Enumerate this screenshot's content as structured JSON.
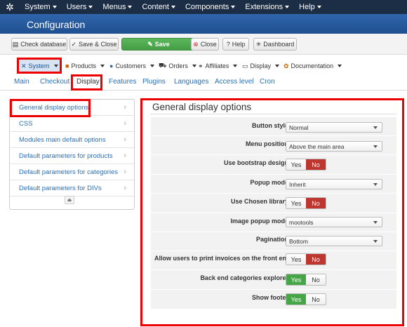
{
  "topmenu": {
    "items": [
      "System",
      "Users",
      "Menus",
      "Content",
      "Components",
      "Extensions",
      "Help"
    ]
  },
  "header": {
    "title": "Configuration"
  },
  "toolbar": {
    "check_database": "Check database",
    "save_close": "Save & Close",
    "save": "Save",
    "close": "Close",
    "help": "Help",
    "dashboard": "Dashboard"
  },
  "component_menu": {
    "items": [
      "System",
      "Products",
      "Customers",
      "Orders",
      "Affiliates",
      "Display",
      "Documentation"
    ],
    "active": "System"
  },
  "tabs": {
    "items": [
      "Main",
      "Checkout",
      "Display",
      "Features",
      "Plugins",
      "Languages",
      "Access level",
      "Cron"
    ],
    "active": "Display"
  },
  "sidebar": {
    "items": [
      "General display options",
      "CSS",
      "Modules main default options",
      "Default parameters for products",
      "Default parameters for categories",
      "Default parameters for DIVs"
    ],
    "active": "General display options"
  },
  "panel": {
    "title": "General display options",
    "fields": {
      "button_style": {
        "label": "Button style",
        "value": "Normal"
      },
      "menu_position": {
        "label": "Menu position",
        "value": "Above the main area"
      },
      "use_bootstrap": {
        "label": "Use bootstrap design",
        "value": "No"
      },
      "popup_mode": {
        "label": "Popup mode",
        "value": "Inherit"
      },
      "use_chosen": {
        "label": "Use Chosen library",
        "value": "No"
      },
      "image_popup_mode": {
        "label": "Image popup mode",
        "value": "mootools"
      },
      "pagination": {
        "label": "Pagination",
        "value": "Bottom"
      },
      "print_invoices": {
        "label": "Allow users to print invoices on the front end",
        "value": "No"
      },
      "cat_explorer": {
        "label": "Back end categories explorer",
        "value": "Yes"
      },
      "show_footer": {
        "label": "Show footer",
        "value": "Yes"
      }
    },
    "yes_label": "Yes",
    "no_label": "No"
  },
  "colors": {
    "topbar": "#1c2d46",
    "title_band": "#2b5fa3",
    "save_green": "#5cb85c",
    "toggle_no": "#bd362f",
    "toggle_yes": "#46a546",
    "highlight": "#ee0000",
    "link": "#2a6fb6"
  }
}
